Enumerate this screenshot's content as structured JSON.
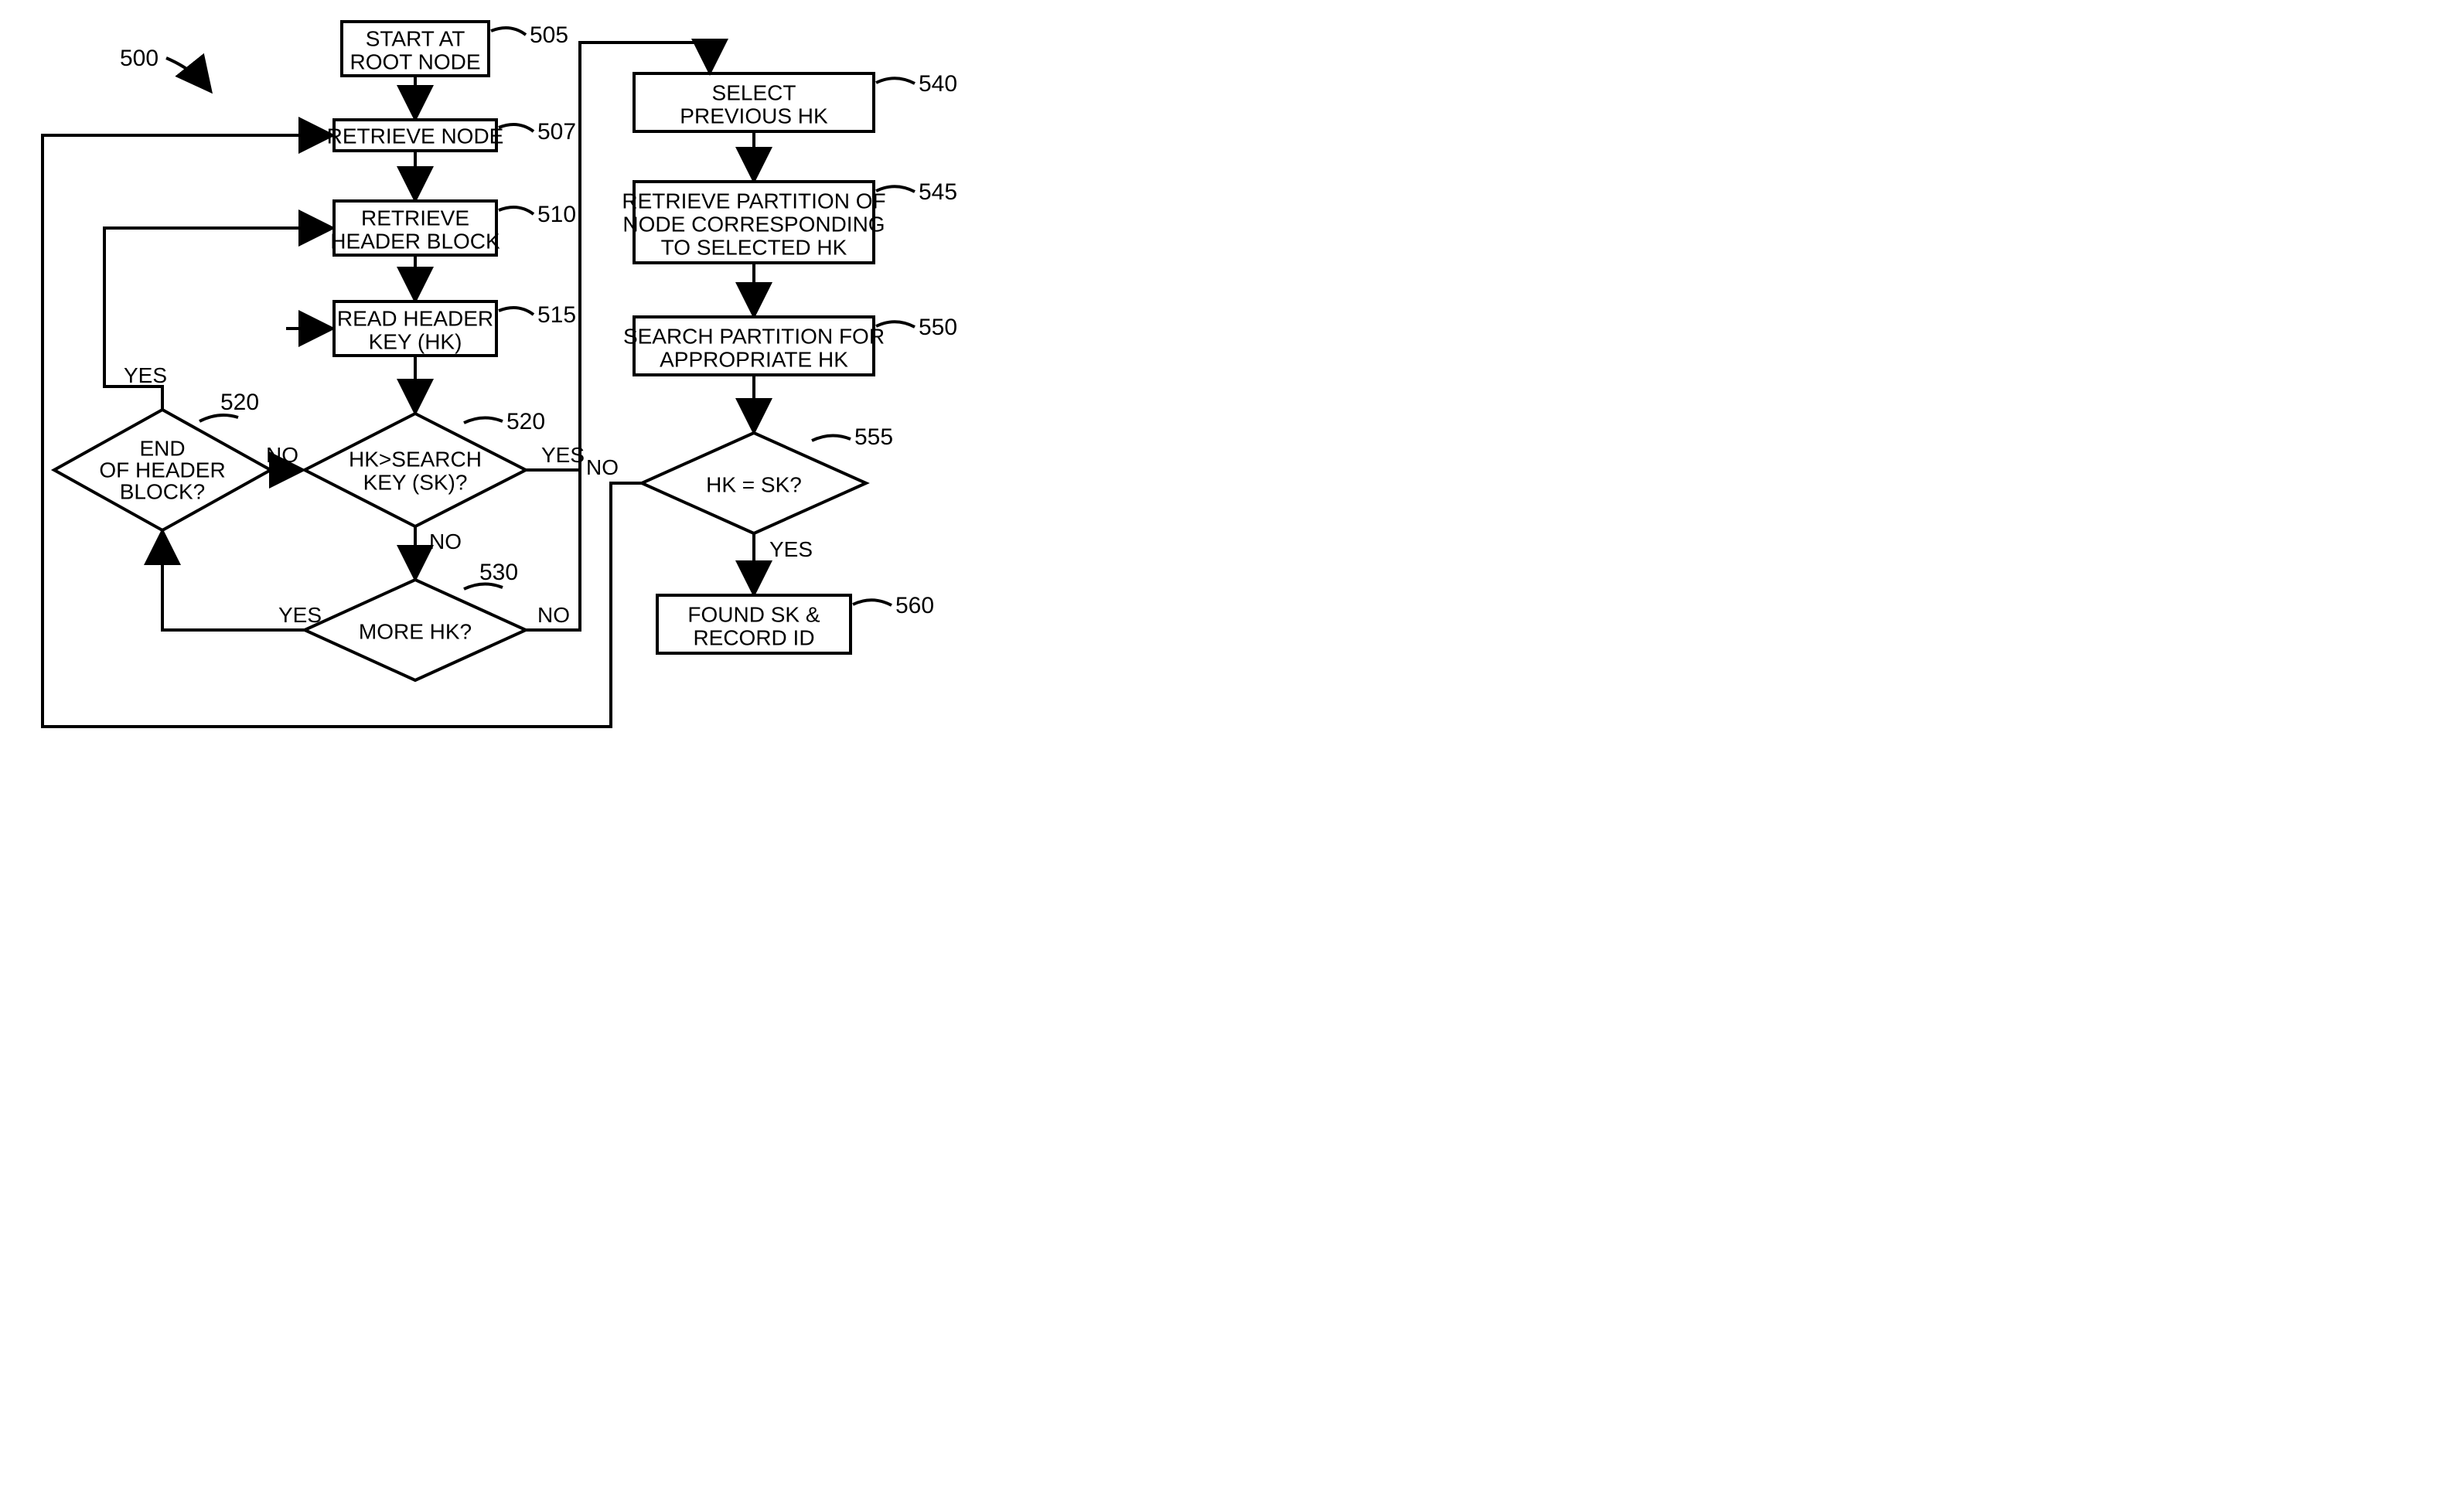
{
  "figureRef": "500",
  "leftColumn": {
    "startRoot": {
      "ref": "505",
      "line1": "START AT",
      "line2": "ROOT NODE"
    },
    "retrieveNode": {
      "ref": "507",
      "text": "RETRIEVE NODE"
    },
    "retrieveHeader": {
      "ref": "510",
      "line1": "RETRIEVE",
      "line2": "HEADER BLOCK"
    },
    "readHeaderKey": {
      "ref": "515",
      "line1": "READ HEADER",
      "line2": "KEY (HK)"
    },
    "endOfHeader": {
      "ref": "520",
      "line1": "END",
      "line2": "OF HEADER",
      "line3": "BLOCK?"
    },
    "hkGtSk": {
      "ref": "520",
      "line1": "HK>SEARCH",
      "line2": "KEY (SK)?"
    },
    "moreHk": {
      "ref": "530",
      "text": "MORE HK?"
    }
  },
  "rightColumn": {
    "selectPrevHk": {
      "ref": "540",
      "line1": "SELECT",
      "line2": "PREVIOUS HK"
    },
    "retrievePartition": {
      "ref": "545",
      "line1": "RETRIEVE PARTITION OF",
      "line2": "NODE CORRESPONDING",
      "line3": "TO SELECTED HK"
    },
    "searchPartition": {
      "ref": "550",
      "line1": "SEARCH PARTITION FOR",
      "line2": "APPROPRIATE HK"
    },
    "hkEqSk": {
      "ref": "555",
      "text": "HK = SK?"
    },
    "foundSk": {
      "ref": "560",
      "line1": "FOUND SK &",
      "line2": "RECORD ID"
    }
  },
  "labels": {
    "yes": "YES",
    "no": "NO"
  }
}
